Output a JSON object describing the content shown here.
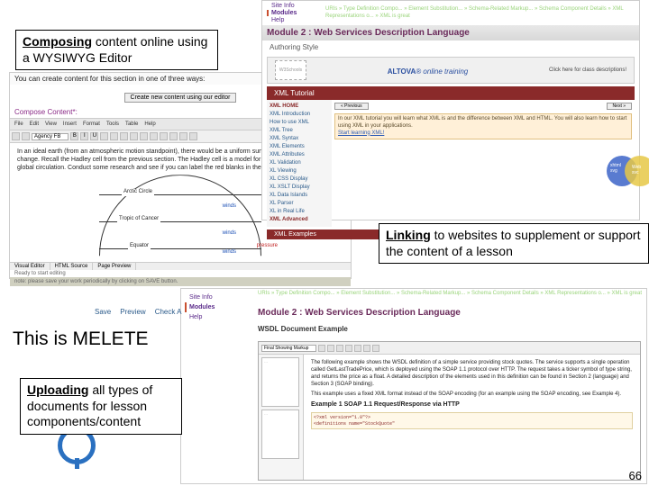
{
  "callouts": {
    "composing": {
      "bold": "Composing",
      "rest": " content online using a WYSIWYG Editor"
    },
    "linking": {
      "bold": "Linking",
      "rest": " to websites to supplement or support the content of a lesson"
    },
    "melete": "This is MELETE",
    "uploading": {
      "bold": "Uploading",
      "rest": " all types of documents for lesson components/content"
    }
  },
  "page_number": "66",
  "editor": {
    "intro": "You can create content for this section in one of three ways:",
    "create_btn": "Create new content using our editor",
    "compose_header": "Compose Content*:",
    "menu": [
      "File",
      "Edit",
      "View",
      "Insert",
      "Format",
      "Tools",
      "Table",
      "Help"
    ],
    "font": "Agency FB",
    "body": "In an ideal earth (from an atmospheric motion standpoint), there would be a uniform surface and no seasonal change. Recall the Hadley cell from the previous section. The Hadley cell is a model for the more complex pattern of global circulation. Conduct some research and see if you can label the red blanks in the figure below.",
    "diagram": {
      "arctic": "Arctic Circle",
      "tropic": "Tropic of Cancer",
      "equator": "Equator",
      "winds": "winds",
      "pressure": "pressure"
    },
    "tabs": [
      "Visual Editor",
      "HTML Source",
      "Page Preview"
    ],
    "ready": "Ready to start editing",
    "footnote": "note: please save your work periodically by clicking on SAVE button."
  },
  "linking": {
    "sidetabs": {
      "info": "Site Info",
      "modules": "Modules",
      "help": "Help"
    },
    "breadcrumb": "URIs » Type Definition Compo... » Element Substitution... » Schema-Related Markup... » Schema Component Details » XML Representations o... » XML is great",
    "module": "Module 2 : Web Services Description Language",
    "auth": "Authoring Style",
    "altova": "ALTOVA",
    "altova_tag": "online training",
    "class_desc": "Click here for class descriptions!",
    "w3s": "W3Schools",
    "tutorial": "XML Tutorial",
    "prev": "« Previous",
    "next": "Next »",
    "sidebar": {
      "hdr_home": "XML HOME",
      "intro": "XML Introduction",
      "how": "How to use XML",
      "tree": "XML Tree",
      "syntax": "XML Syntax",
      "elements": "XML Elements",
      "attr": "XML Attributes",
      "valid": "XL Validation",
      "view": "XL Viewing",
      "css": "XL CSS Display",
      "xslt": "XL XSLT Display",
      "data": "XL Data Islands",
      "parser": "XL Parser",
      "real": "XL in Real Life",
      "hdr_adv": "XML Advanced"
    },
    "note": "In our XML tutorial you will learn what XML is and the difference between XML and HTML. You will also learn how to start using XML in your applications.",
    "start_link": "Start learning XML!",
    "venn1": "xhtml\\nxforms\\nsmil\\nsvg",
    "venn2": "Web\\nservices",
    "examples": "XML Examples"
  },
  "upload": {
    "actions": [
      "Save",
      "Preview",
      "Check A"
    ],
    "sidetabs": {
      "info": "Site Info",
      "modules": "Modules",
      "help": "Help"
    },
    "breadcrumb": "URIs » Type Definition Compo... » Element Substitution... » Schema-Related Markup... » Schema Component Details » XML Representations o... » XML is great",
    "module": "Module 2 : Web Services Description Language",
    "doc_example": "WSDL Document Example",
    "toolbar_drop": "Final Showing Markup",
    "para1": "The following example shows the WSDL definition of a simple service providing stock quotes. The service supports a single operation called GetLastTradePrice, which is deployed using the SOAP 1.1 protocol over HTTP. The request takes a ticker symbol of type string, and returns the price as a float. A detailed description of the elements used in this definition can be found in Section 2 (language) and Section 3 (SOAP binding).",
    "para2": "This example uses a fixed XML format instead of the SOAP encoding (for an example using the SOAP encoding, see Example 4).",
    "example_title": "Example 1 SOAP 1.1 Request/Response via HTTP",
    "code1": "<?xml version=\"1.0\"?>",
    "code2": "<definitions name=\"StockQuote\""
  }
}
